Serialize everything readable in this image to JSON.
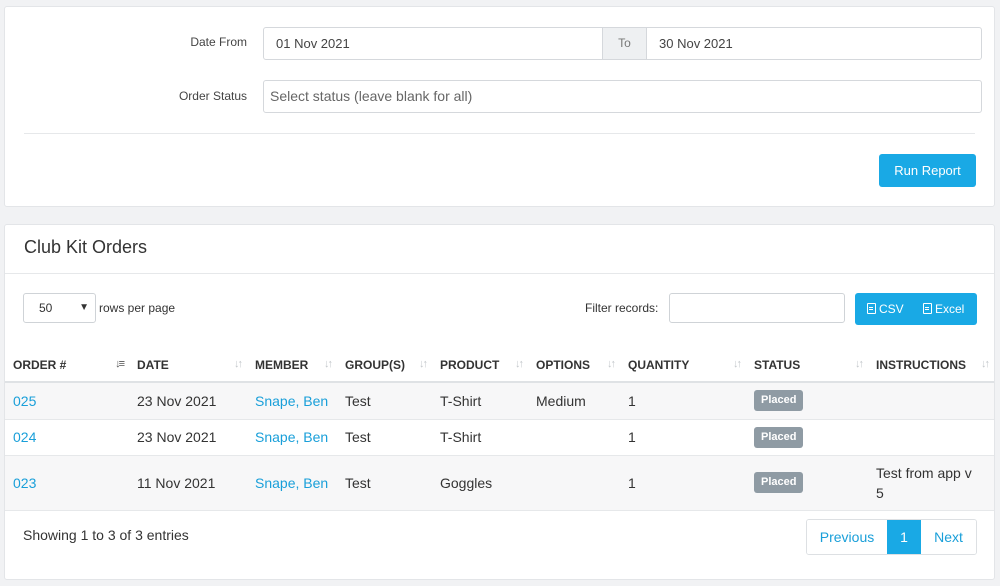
{
  "filters": {
    "date_from_label": "Date From",
    "date_from_value": "01 Nov 2021",
    "to_label": "To",
    "date_to_value": "30 Nov 2021",
    "order_status_label": "Order Status",
    "order_status_placeholder": "Select status (leave blank for all)",
    "run_report_label": "Run Report"
  },
  "orders": {
    "title": "Club Kit Orders",
    "page_size": "50",
    "rows_per_page_label": "rows per page",
    "filter_label": "Filter records:",
    "export_csv_label": "CSV",
    "export_excel_label": "Excel",
    "columns": [
      "ORDER #",
      "DATE",
      "MEMBER",
      "GROUP(S)",
      "PRODUCT",
      "OPTIONS",
      "QUANTITY",
      "STATUS",
      "INSTRUCTIONS"
    ],
    "rows": [
      {
        "order": "025",
        "date": "23 Nov 2021",
        "member": "Snape, Ben",
        "groups": "Test",
        "product": "T-Shirt",
        "options": "Medium",
        "quantity": "1",
        "status": "Placed",
        "instructions": ""
      },
      {
        "order": "024",
        "date": "23 Nov 2021",
        "member": "Snape, Ben",
        "groups": "Test",
        "product": "T-Shirt",
        "options": "",
        "quantity": "1",
        "status": "Placed",
        "instructions": ""
      },
      {
        "order": "023",
        "date": "11 Nov 2021",
        "member": "Snape, Ben",
        "groups": "Test",
        "product": "Goggles",
        "options": "",
        "quantity": "1",
        "status": "Placed",
        "instructions": "Test from app v 5"
      }
    ],
    "showing_text": "Showing 1 to 3 of 3 entries",
    "pagination": {
      "previous": "Previous",
      "current": "1",
      "next": "Next"
    }
  },
  "colors": {
    "accent": "#19a9e5",
    "link": "#199fd9",
    "badge": "#8f9ba4"
  }
}
